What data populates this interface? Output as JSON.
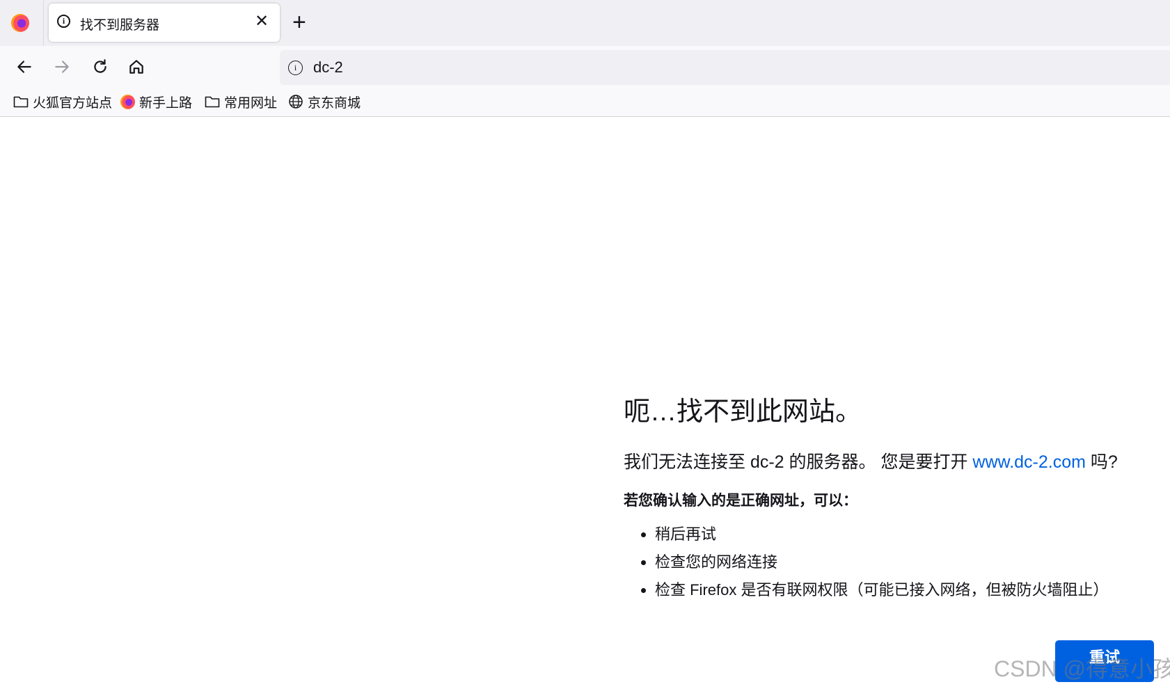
{
  "tab": {
    "title": "找不到服务器",
    "close_glyph": "✕"
  },
  "new_tab_glyph": "+",
  "url_bar": {
    "url": "dc-2"
  },
  "bookmarks": [
    {
      "label": "火狐官方站点",
      "icon": "folder-icon"
    },
    {
      "label": "新手上路",
      "icon": "firefox-icon"
    },
    {
      "label": "常用网址",
      "icon": "folder-icon"
    },
    {
      "label": "京东商城",
      "icon": "globe-icon"
    }
  ],
  "error": {
    "title": "呃…找不到此网站。",
    "desc_prefix": "我们无法连接至 dc-2 的服务器。 您是要打开 ",
    "desc_link": "www.dc-2.com",
    "desc_suffix": " 吗?",
    "subtitle": "若您确认输入的是正确网址，可以：",
    "suggestions": [
      "稍后再试",
      "检查您的网络连接",
      "检查 Firefox 是否有联网权限（可能已接入网络，但被防火墙阻止）"
    ],
    "retry_label": "重试"
  },
  "watermark": "CSDN @得意小孩",
  "colors": {
    "link": "#0061e0",
    "button": "#0061e0",
    "toolbar": "#f9f9fb",
    "tabstrip": "#f0f0f4"
  }
}
